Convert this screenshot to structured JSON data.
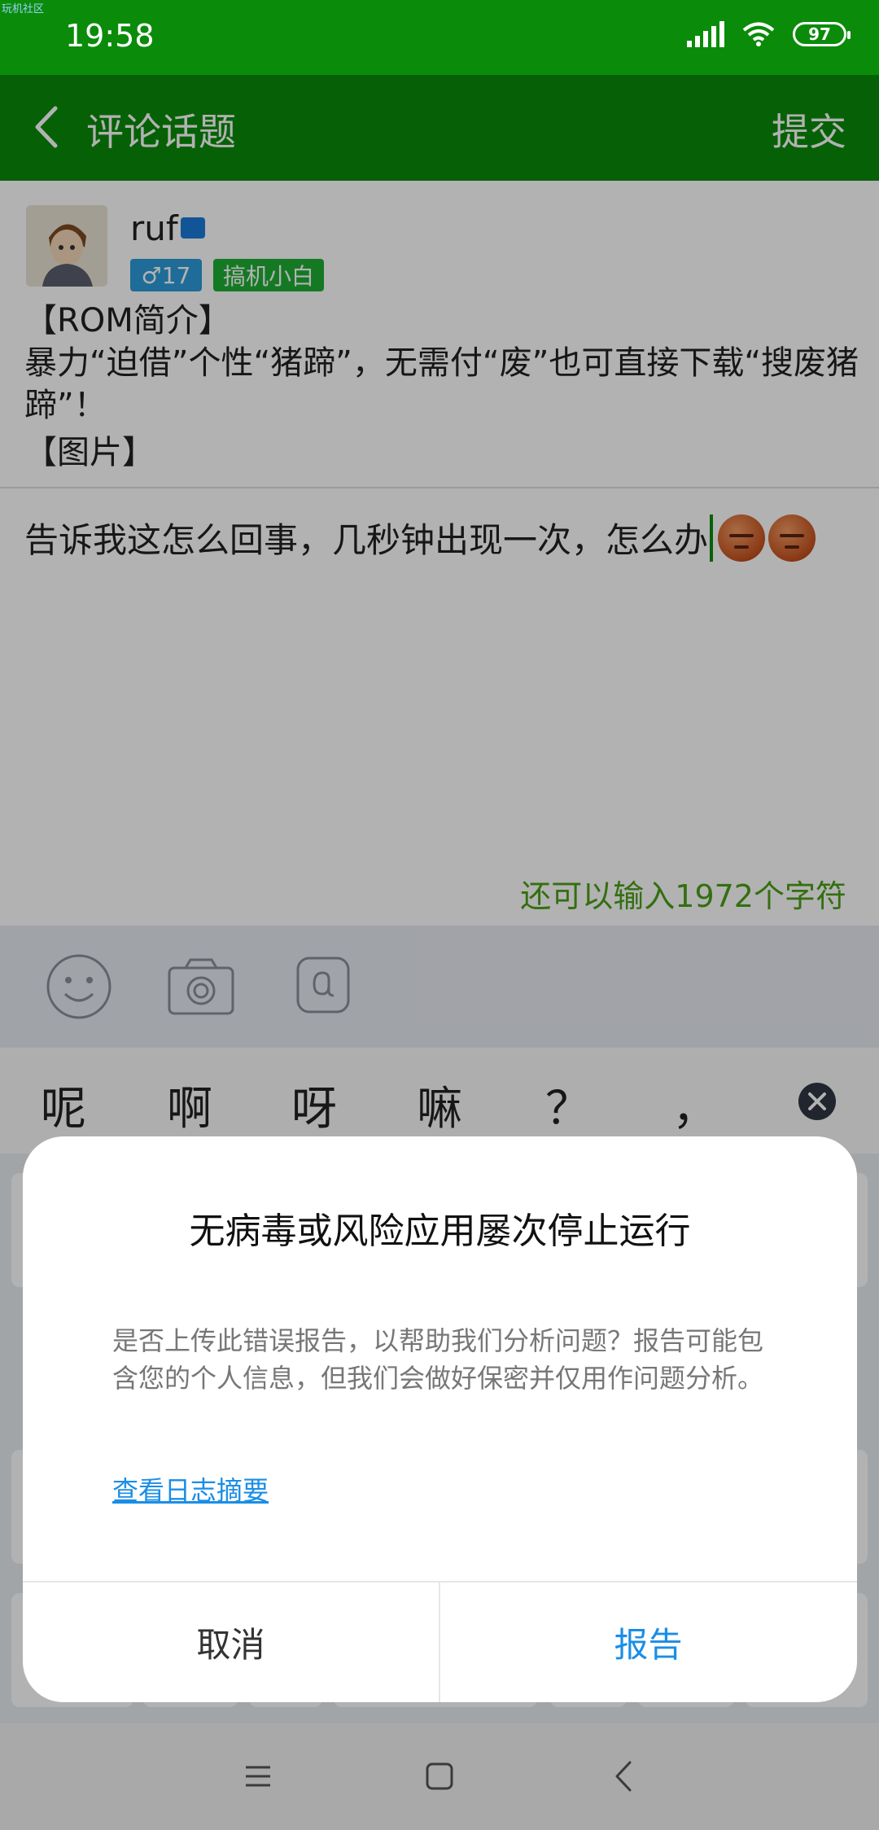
{
  "status_bar": {
    "corner_tag": "玩机社区",
    "time": "19:58",
    "battery": "97",
    "icons": [
      "signal-icon",
      "wifi-icon",
      "battery-icon"
    ]
  },
  "app_bar": {
    "title": "评论话题",
    "submit_label": "提交",
    "back_icon": "chevron-left-icon"
  },
  "post": {
    "username": "ruf",
    "gender_level": "♂17",
    "level_badge": "搞机小白",
    "topic_lines": [
      "【ROM简介】",
      "暴力“迫借”个性“猪蹄”，无需付“废”也可直接下载“搜废猪蹄”！"
    ],
    "image_placeholder": "【图片】"
  },
  "comment": {
    "text": "告诉我这怎么回事，几秒钟出现一次，怎么办",
    "emoji_count": 2
  },
  "counter_text": "还可以输入1972个字符",
  "toolbar": {
    "icons": [
      "emoji-icon",
      "camera-icon",
      "at-icon"
    ]
  },
  "keyboard": {
    "suggestions": [
      "呢",
      "啊",
      "呀",
      "嘛",
      "？",
      "，"
    ]
  },
  "dialog": {
    "title": "无病毒或风险应用屡次停止运行",
    "body": "是否上传此错误报告，以帮助我们分析问题？报告可能包含您的个人信息，但我们会做好保密并仅用作问题分析。",
    "link": "查看日志摘要",
    "cancel_label": "取消",
    "report_label": "报告"
  },
  "colors": {
    "brand_green": "#0a8c0a",
    "link_blue": "#1a8ee6",
    "counter_green": "#4aa018"
  }
}
